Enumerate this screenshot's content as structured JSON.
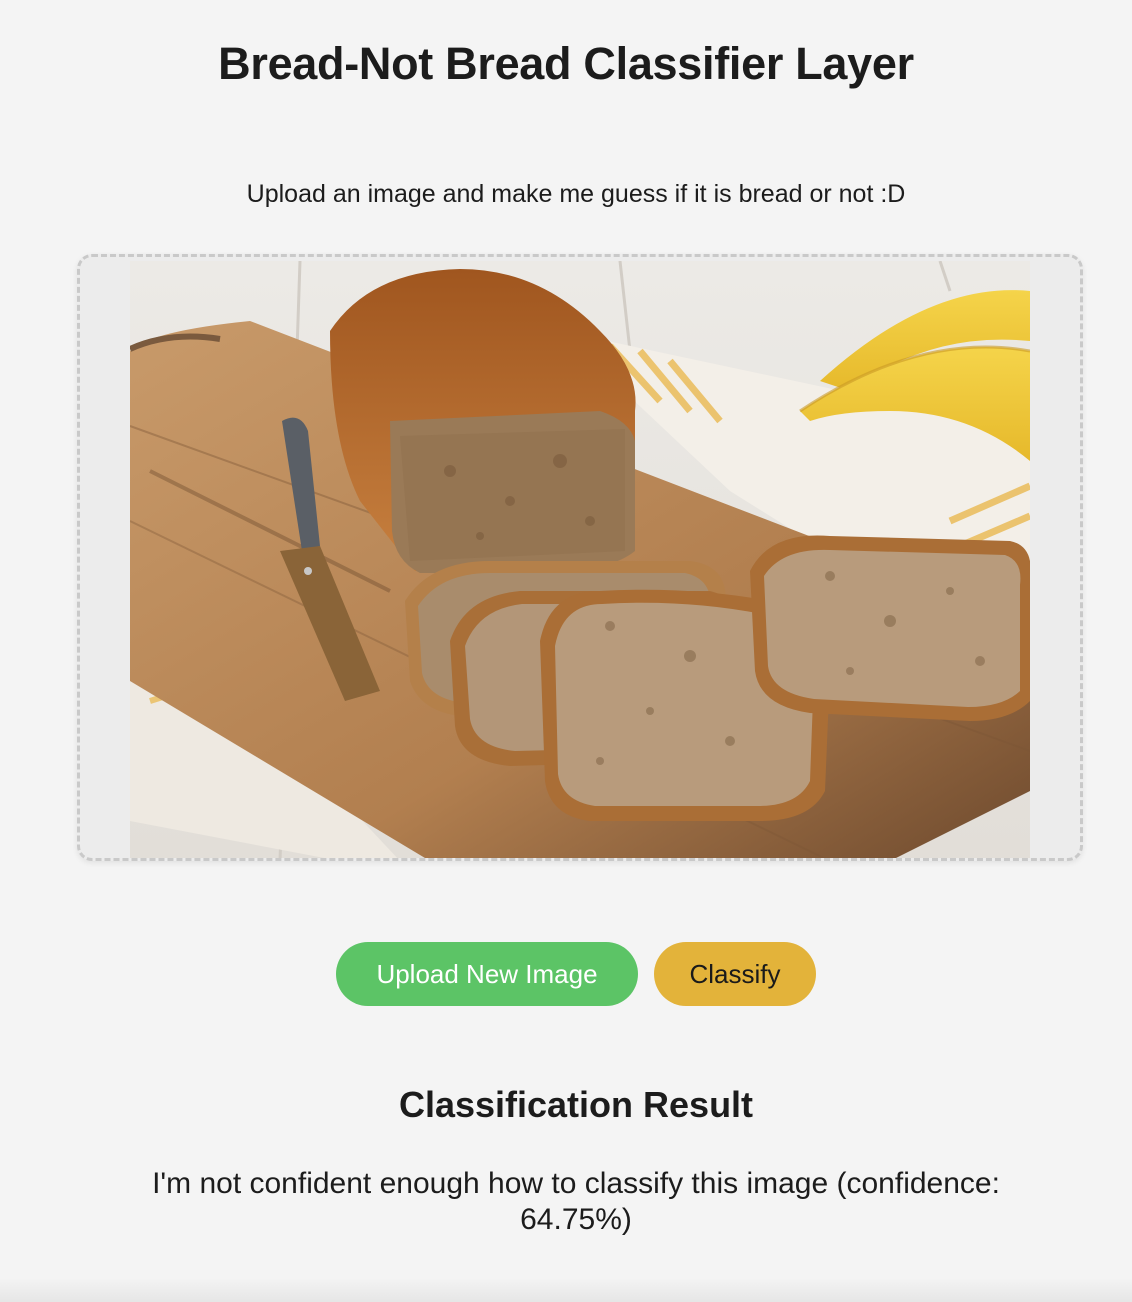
{
  "header": {
    "title": "Bread-Not Bread Classifier Layer"
  },
  "instructions": {
    "text": "Upload an image and make me guess if it is bread or not :D"
  },
  "preview": {
    "alt": "Uploaded image preview"
  },
  "actions": {
    "upload_label": "Upload New Image",
    "classify_label": "Classify"
  },
  "result": {
    "title": "Classification Result",
    "message": "I'm not confident enough how to classify this image (confidence: 64.75%)"
  },
  "colors": {
    "background": "#f4f4f4",
    "upload_button": "#5cc466",
    "classify_button": "#e3b33a",
    "dropzone_border": "#c9c9c9"
  }
}
